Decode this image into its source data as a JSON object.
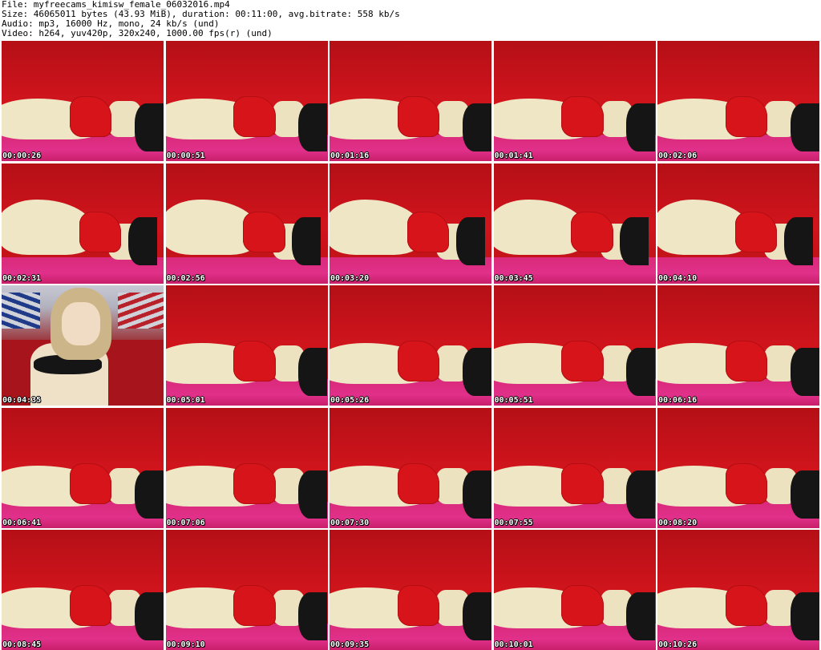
{
  "header": {
    "file_line": "File: myfreecams_kimisw_female_06032016.mp4",
    "size_line": "Size: 46065011 bytes (43.93 MiB), duration: 00:11:00, avg.bitrate: 558 kb/s",
    "audio_line": "Audio: mp3, 16000 Hz, mono, 24 kb/s (und)",
    "video_line": "Video: h264, yuv420p, 320x240, 1000.00 fps(r) (und)"
  },
  "thumbnails": [
    {
      "timestamp": "00:00:26",
      "variant": "lying"
    },
    {
      "timestamp": "00:00:51",
      "variant": "lying"
    },
    {
      "timestamp": "00:01:16",
      "variant": "lying"
    },
    {
      "timestamp": "00:01:41",
      "variant": "lying"
    },
    {
      "timestamp": "00:02:06",
      "variant": "lying"
    },
    {
      "timestamp": "00:02:31",
      "variant": "alt"
    },
    {
      "timestamp": "00:02:56",
      "variant": "alt"
    },
    {
      "timestamp": "00:03:20",
      "variant": "alt"
    },
    {
      "timestamp": "00:03:45",
      "variant": "alt"
    },
    {
      "timestamp": "00:04:10",
      "variant": "alt"
    },
    {
      "timestamp": "00:04:35",
      "variant": "face"
    },
    {
      "timestamp": "00:05:01",
      "variant": "lying"
    },
    {
      "timestamp": "00:05:26",
      "variant": "lying"
    },
    {
      "timestamp": "00:05:51",
      "variant": "lying"
    },
    {
      "timestamp": "00:06:16",
      "variant": "lying"
    },
    {
      "timestamp": "00:06:41",
      "variant": "lying"
    },
    {
      "timestamp": "00:07:06",
      "variant": "lying"
    },
    {
      "timestamp": "00:07:30",
      "variant": "lying"
    },
    {
      "timestamp": "00:07:55",
      "variant": "lying"
    },
    {
      "timestamp": "00:08:20",
      "variant": "lying"
    },
    {
      "timestamp": "00:08:45",
      "variant": "lying"
    },
    {
      "timestamp": "00:09:10",
      "variant": "lying"
    },
    {
      "timestamp": "00:09:35",
      "variant": "lying"
    },
    {
      "timestamp": "00:10:01",
      "variant": "lying"
    },
    {
      "timestamp": "00:10:26",
      "variant": "lying"
    }
  ]
}
